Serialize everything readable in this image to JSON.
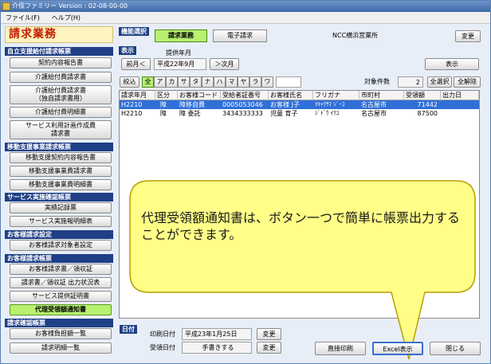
{
  "window": {
    "title": "介保ファミリー Version : 02-08-00-00"
  },
  "menu": [
    "ファイル(F)",
    "ヘルプ(H)"
  ],
  "page_title": "請求業務",
  "sidebar": {
    "sections": [
      {
        "head": "自立支援給付請求帳票",
        "items": [
          "契約内容報告書",
          "介護給付費請求書",
          "介護給付費請求書\n（独自請求書用）",
          "介護給付費明細書",
          "サービス利用計画作成費\n請求書"
        ]
      },
      {
        "head": "移動支援事業請求帳票",
        "items": [
          "移動支援契約内容報告書",
          "移動支援事業費請求書",
          "移動支援事業費明細書"
        ]
      },
      {
        "head": "サービス実施確認帳票",
        "items": [
          "実績記録票",
          "サービス実施報明細表"
        ]
      },
      {
        "head": "お客様請求設定",
        "items": [
          "お客様請求対象者設定"
        ]
      },
      {
        "head": "お客様請求帳票",
        "items": [
          "お客様請求書／領収証",
          "請求書／領収証 出力状況表",
          "サービス提供証明書",
          "代理受領額通知書"
        ]
      },
      {
        "head": "請求確認帳票",
        "items": [
          "お客様負担額一覧",
          "請求明細一覧"
        ]
      }
    ]
  },
  "function_select": {
    "label": "機能選択",
    "tabs": [
      "請求業務",
      "電子請求"
    ],
    "office": "NCC横浜営業所",
    "change_label": "変更"
  },
  "display": {
    "label": "表示",
    "period_label": "提供年月",
    "prev_label": "前月＜",
    "period_value": "平成22年9月",
    "next_label": "＞次月",
    "show_label": "表示"
  },
  "filter": {
    "narrow_label": "絞込",
    "kana": [
      "全",
      "ア",
      "カ",
      "サ",
      "タ",
      "ナ",
      "ハ",
      "マ",
      "ヤ",
      "ラ",
      "ワ"
    ],
    "count_label": "対象件数",
    "count_value": "2",
    "select_all_label": "全選択",
    "deselect_all_label": "全解除"
  },
  "table": {
    "columns": [
      "請求年月",
      "区分",
      "お客様コード",
      "受給者証番号",
      "お客様氏名",
      "フリガナ",
      "市町村",
      "受領額",
      "出力日"
    ],
    "rows": [
      [
        "H2210",
        "障",
        "障移自費",
        "0005053046",
        "お客様 J子",
        "ｵｷｬｸｻﾏ ｼﾞｰｺ",
        "名古屋市",
        "71442",
        ""
      ],
      [
        "H2210",
        "障",
        "障 委託",
        "3434333333",
        "児童 育子",
        "ｼﾞﾄﾞｳ ｲｸｺ",
        "名古屋市",
        "87500",
        ""
      ]
    ]
  },
  "dates": {
    "label": "日付",
    "print_label": "印刷日付",
    "print_value": "平成23年1月25日",
    "receive_label": "受領日付",
    "receive_value": "手書きする",
    "change_label": "変更"
  },
  "actions": {
    "direct_print": "直接印刷",
    "excel": "Excel表示",
    "close": "閉じる"
  },
  "callout": {
    "text": "代理受領額通知書は、ボタン一つで簡単に帳票出力することができます。"
  },
  "colors": {
    "accent_green": "#b8f070",
    "section_navy": "#1f3f86",
    "callout_yellow": "#ffff88",
    "title_red": "#c02000",
    "selection_blue": "#2f6fd8"
  }
}
